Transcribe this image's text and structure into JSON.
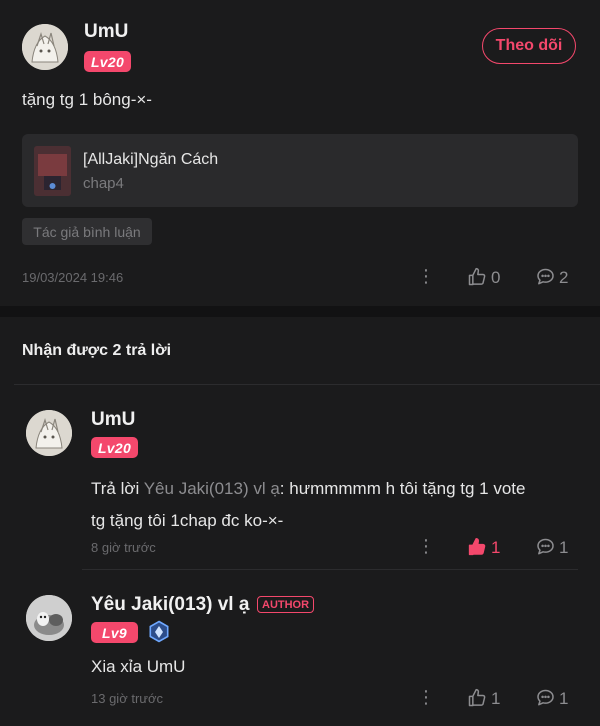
{
  "post": {
    "user_name": "UmU",
    "level": "Lv20",
    "follow_label": "Theo dõi",
    "text": "tặng tg 1 bông-×-",
    "work_title": "[AllJaki]Ngăn Cách",
    "work_chapter": "chap4",
    "tag": "Tác giả bình luận",
    "timestamp": "19/03/2024 19:46",
    "like_count": "0",
    "comment_count": "2"
  },
  "replies_header": "Nhận được 2 trả lời",
  "replies": [
    {
      "user_name": "UmU",
      "level": "Lv20",
      "reply_prefix": "Trả lời ",
      "reply_target": "Yêu Jaki(013) vl ạ",
      "text_line1": ": hưmmmmm h tôi tặng tg 1 vote",
      "text_line2": "tg tặng tôi 1chap đc ko-×-",
      "time": "8 giờ trước",
      "like_count": "1",
      "comment_count": "1",
      "liked": true
    },
    {
      "user_name": "Yêu Jaki(013) vl ạ",
      "author_badge": "AUTHOR",
      "level": "Lv9",
      "text": "Xia xỉa UmU",
      "time": "13 giờ trước",
      "like_count": "1",
      "comment_count": "1",
      "liked": false
    }
  ],
  "colors": {
    "accent": "#f4486c",
    "background": "#1b1b1c",
    "muted": "#6a6a6d"
  }
}
